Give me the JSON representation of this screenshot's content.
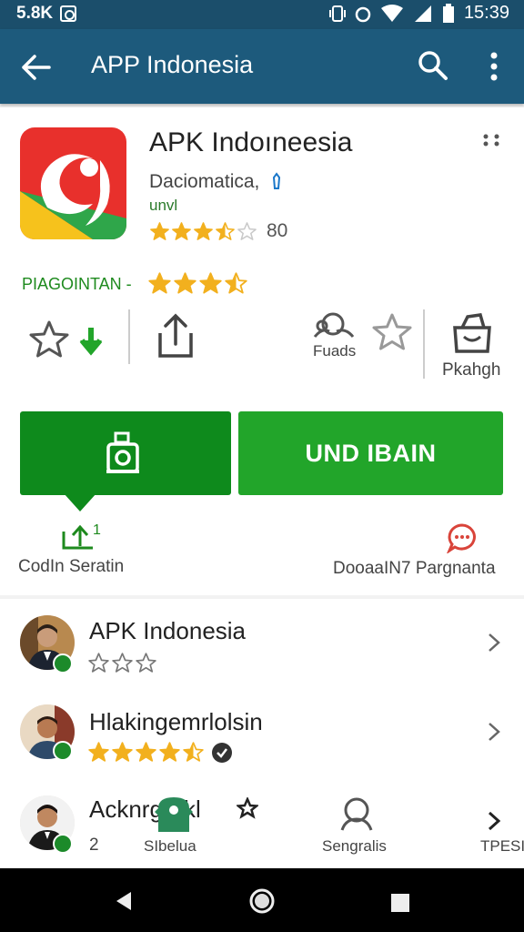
{
  "status_bar": {
    "left_text": "5.8K",
    "time": "15:39"
  },
  "app_bar": {
    "title": "APP Indonesia"
  },
  "app": {
    "name": "APK Indoıneesia",
    "developer": "Daciomatica,",
    "sub_label": "unvl",
    "rating_stars": 3.5,
    "rating_count": "80",
    "pegi_label": "PIAGOINTAN -",
    "pegi_stars": 3.5,
    "colors": {
      "icon_red": "#e8302c",
      "icon_yellow": "#f6c21c"
    }
  },
  "actions": {
    "share_label": "",
    "third_label": "Fuads",
    "fourth_label": "Pkahgh"
  },
  "buttons": {
    "primary_label": "UND IBAIN",
    "colors": {
      "left": "#0e8a1c",
      "right": "#22a52a"
    }
  },
  "secondary_actions": {
    "left_count": "1",
    "left_label": "CodIn Seratin",
    "right_label": "DooaaIN7 Pargnanta"
  },
  "list": [
    {
      "title": "APK Indonesia",
      "stars": 0,
      "extra": ""
    },
    {
      "title": "Hlakingemrlolsin",
      "stars": 4.5,
      "extra": ""
    },
    {
      "title": "Acknrgrakl",
      "stars": 0,
      "extra": "2"
    }
  ],
  "bottom_overlay": {
    "left_label": "SIbelua",
    "mid_label": "Sengralis",
    "right_label": "TPESI"
  }
}
